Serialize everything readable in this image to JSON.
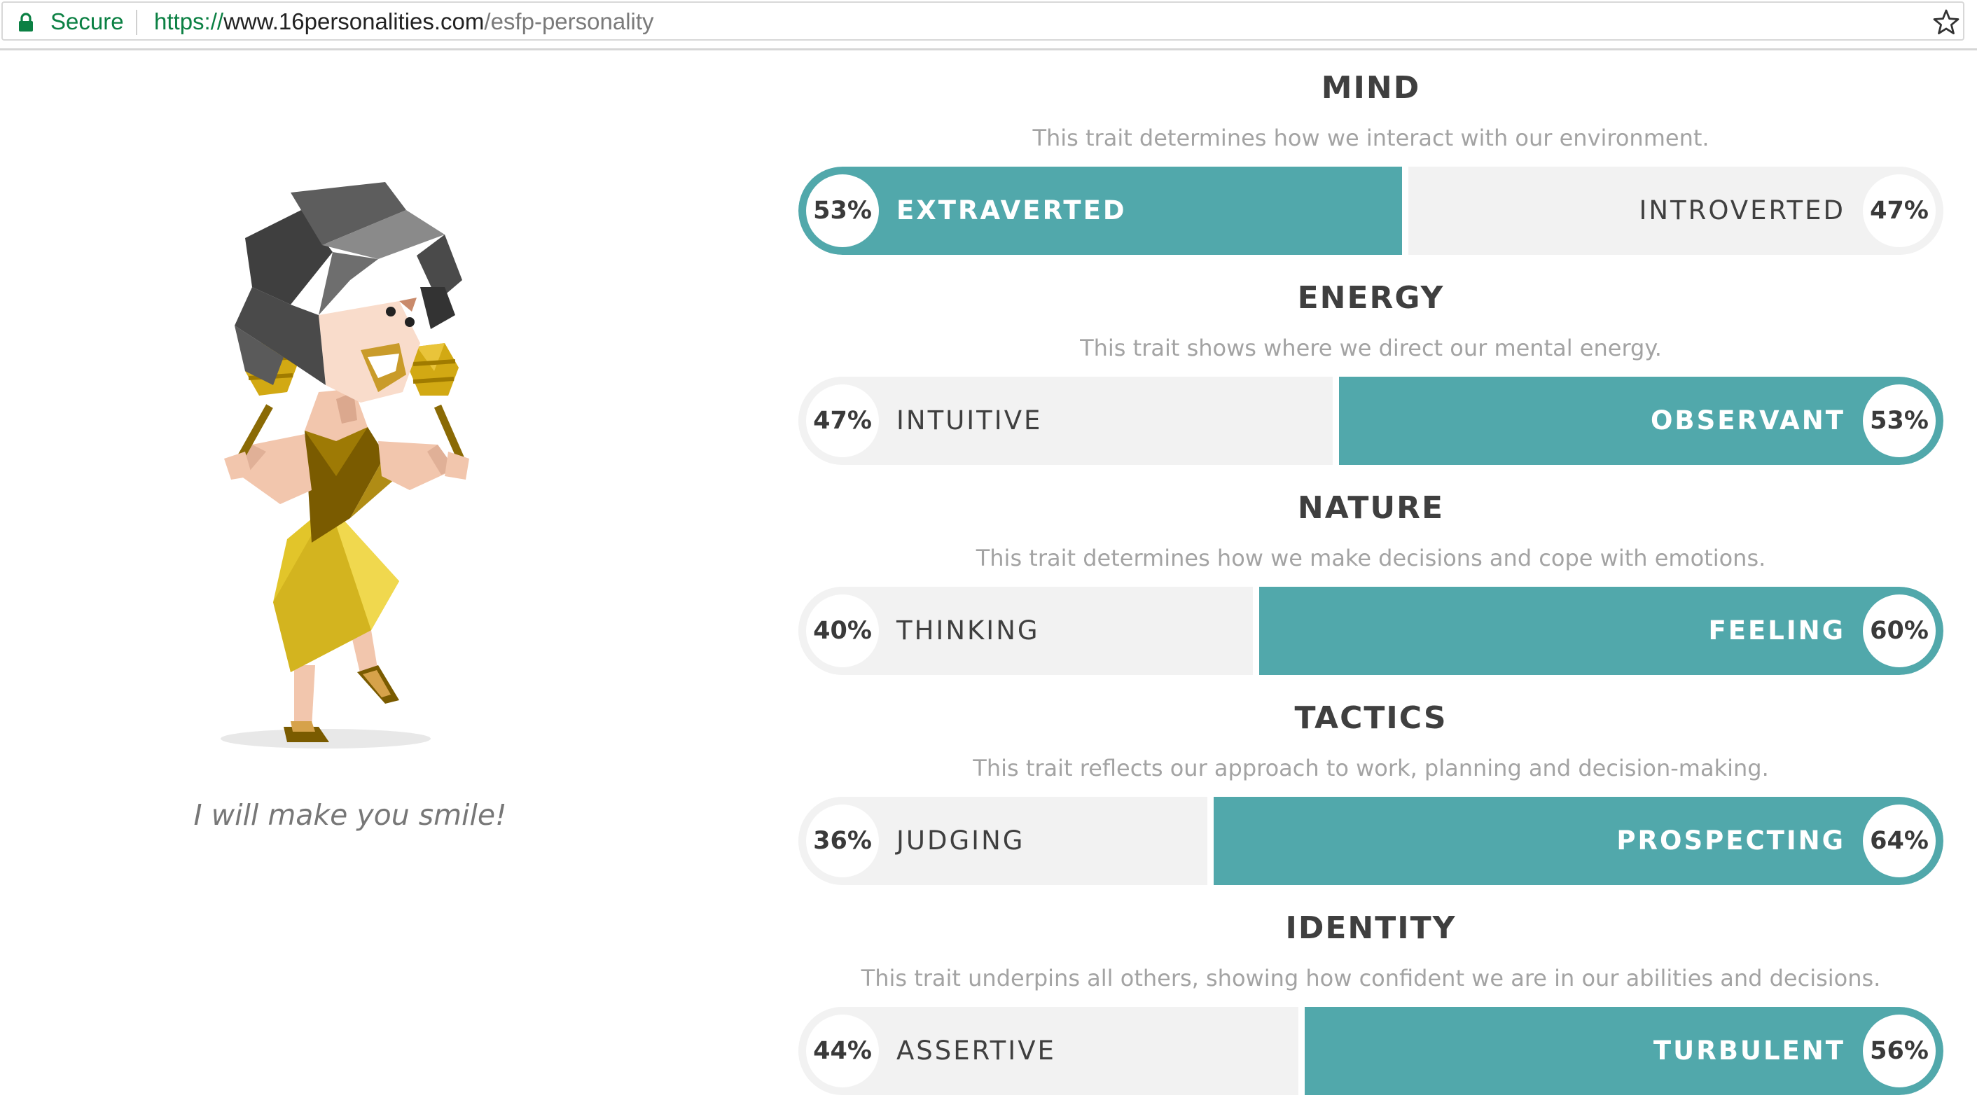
{
  "browser": {
    "secure_label": "Secure",
    "url_scheme": "https://",
    "url_host": "www.16personalities.com",
    "url_path": "/esfp-personality",
    "lock_icon": "lock-icon",
    "bookmark_icon": "star-icon"
  },
  "character": {
    "tagline": "I will make you smile!"
  },
  "colors": {
    "accent": "#51a8ab",
    "track": "#f2f2f2"
  },
  "traits": [
    {
      "title": "MIND",
      "description": "This trait determines how we interact with our environment.",
      "left": {
        "label": "EXTRAVERTED",
        "percent": "53%"
      },
      "right": {
        "label": "INTROVERTED",
        "percent": "47%"
      },
      "active_side": "left",
      "left_share": 0.53
    },
    {
      "title": "ENERGY",
      "description": "This trait shows where we direct our mental energy.",
      "left": {
        "label": "INTUITIVE",
        "percent": "47%"
      },
      "right": {
        "label": "OBSERVANT",
        "percent": "53%"
      },
      "active_side": "right",
      "left_share": 0.47
    },
    {
      "title": "NATURE",
      "description": "This trait determines how we make decisions and cope with emotions.",
      "left": {
        "label": "THINKING",
        "percent": "40%"
      },
      "right": {
        "label": "FEELING",
        "percent": "60%"
      },
      "active_side": "right",
      "left_share": 0.4
    },
    {
      "title": "TACTICS",
      "description": "This trait reflects our approach to work, planning and decision-making.",
      "left": {
        "label": "JUDGING",
        "percent": "36%"
      },
      "right": {
        "label": "PROSPECTING",
        "percent": "64%"
      },
      "active_side": "right",
      "left_share": 0.36
    },
    {
      "title": "IDENTITY",
      "description": "This trait underpins all others, showing how confident we are in our abilities and decisions.",
      "left": {
        "label": "ASSERTIVE",
        "percent": "44%"
      },
      "right": {
        "label": "TURBULENT",
        "percent": "56%"
      },
      "active_side": "right",
      "left_share": 0.44
    }
  ]
}
